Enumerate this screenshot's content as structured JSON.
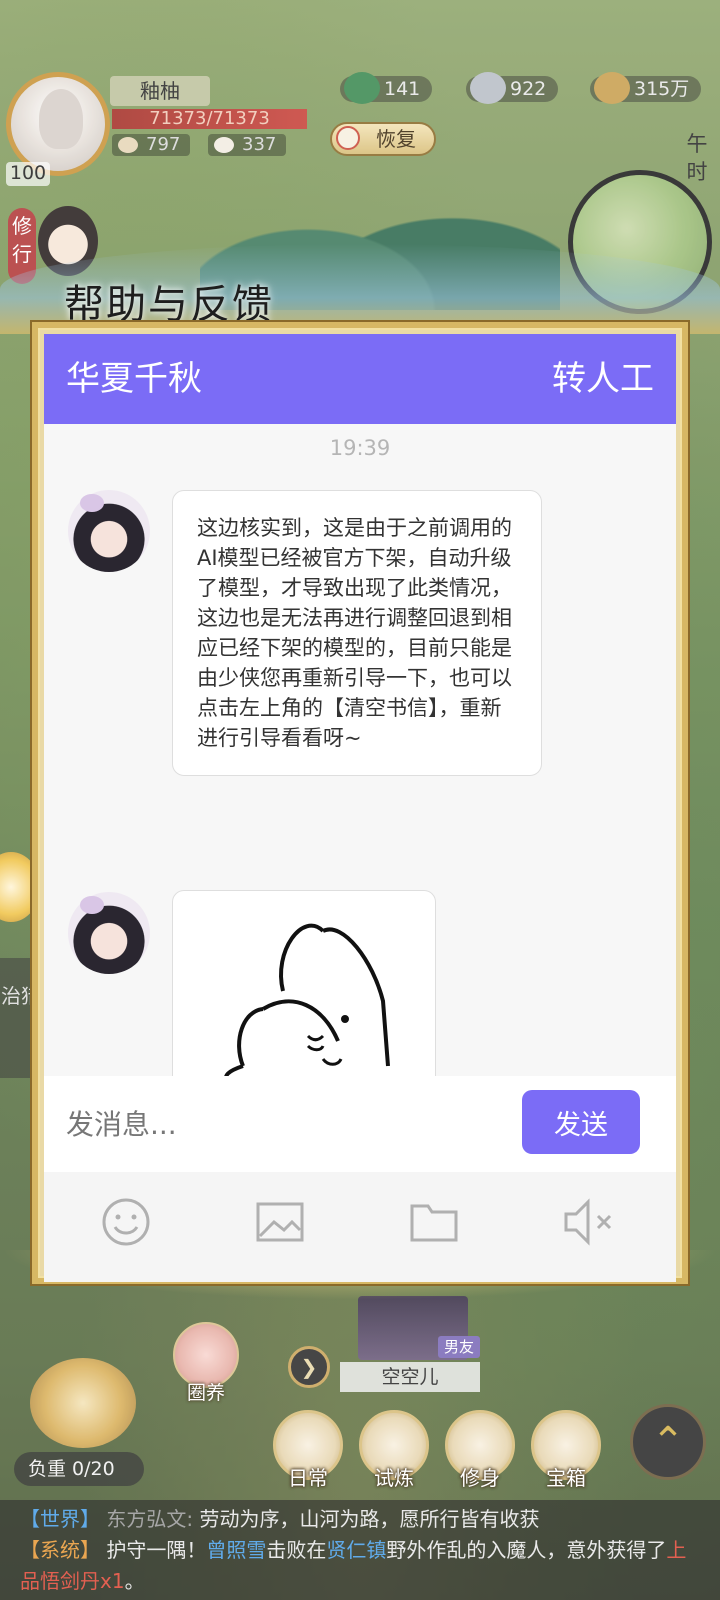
{
  "hud": {
    "player_name": "釉柚",
    "level": "100",
    "hp": "71373/71373",
    "stat_a": "797",
    "stat_b": "337",
    "res_1": "141",
    "res_2": "922",
    "res_3": "315万",
    "recover_label": "恢复",
    "time_label": "午时",
    "cultivate_tag": "修行",
    "side_text": "治猎"
  },
  "dialog": {
    "title": "帮助与反馈",
    "header_left": "华夏千秋",
    "header_right": "转人工",
    "timestamp": "19:39",
    "message_1": "这边核实到，这是由于之前调用的AI模型已经被官方下架，自动升级了模型，才导致出现了此类情况，这边也是无法再进行调整回退到相应已经下架的模型的，目前只能是由少侠您再重新引导一下，也可以点击左上角的【清空书信】，重新进行引导看看呀~",
    "input_placeholder": "发消息...",
    "send_label": "发送",
    "tools": [
      "smile-icon",
      "image-icon",
      "folder-icon",
      "mute-icon"
    ]
  },
  "game": {
    "pet_tag": "男友",
    "pet_name": "空空儿",
    "pen_label": "圈养",
    "load_label": "负重 0/20",
    "dock": [
      "日常",
      "试炼",
      "修身",
      "宝箱"
    ]
  },
  "log": {
    "world_tag": "【世界】",
    "world_speaker": "东方弘文:",
    "world_text": "劳动为序，山河为路，愿所行皆有收获",
    "sys_tag": "【系统】",
    "sys_text_a": "护守一隅！",
    "sys_player": "曾照雪",
    "sys_text_b": "击败在",
    "sys_place": "贤仁镇",
    "sys_text_c": "野外作乱的入魔人，意外获得了",
    "sys_item": "上品悟剑丹x1",
    "sys_end": "。"
  },
  "colors": {
    "accent": "#7b6cf6",
    "frame_gold": "#d7b864"
  }
}
